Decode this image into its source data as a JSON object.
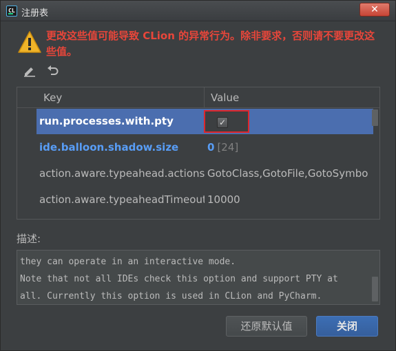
{
  "window": {
    "title": "注册表",
    "close_glyph": "✕"
  },
  "warning": {
    "icon": "warning-triangle-icon",
    "text": "更改这些值可能导致 CLion 的异常行为。除非要求，否则请不要更改这些值。"
  },
  "toolbar": {
    "edit_icon": "pencil-icon",
    "revert_icon": "undo-icon"
  },
  "table": {
    "columns": [
      "Key",
      "Value"
    ],
    "rows": [
      {
        "key": "run.processes.with.pty",
        "value_type": "checkbox",
        "checked": true,
        "selected": true,
        "bold": true
      },
      {
        "key": "ide.balloon.shadow.size",
        "value": "0",
        "default": "[24]",
        "bold": true
      },
      {
        "key": "action.aware.typeahead.actions",
        "value": "GotoClass,GotoFile,GotoSymbo"
      },
      {
        "key": "action.aware.typeaheadTimeout",
        "value": "10000"
      }
    ]
  },
  "description": {
    "label": "描述:",
    "lines": [
      "they can operate in an interactive mode.",
      "Note that not all IDEs check this option and support PTY at",
      "all. Currently this option is used in CLion and PyCharm."
    ]
  },
  "buttons": {
    "reset": "还原默认值",
    "close": "关闭"
  },
  "colors": {
    "selection": "#4b6eaf",
    "warning": "#e8463a",
    "highlight_box": "#e0262c",
    "modified_key": "#589df6"
  }
}
